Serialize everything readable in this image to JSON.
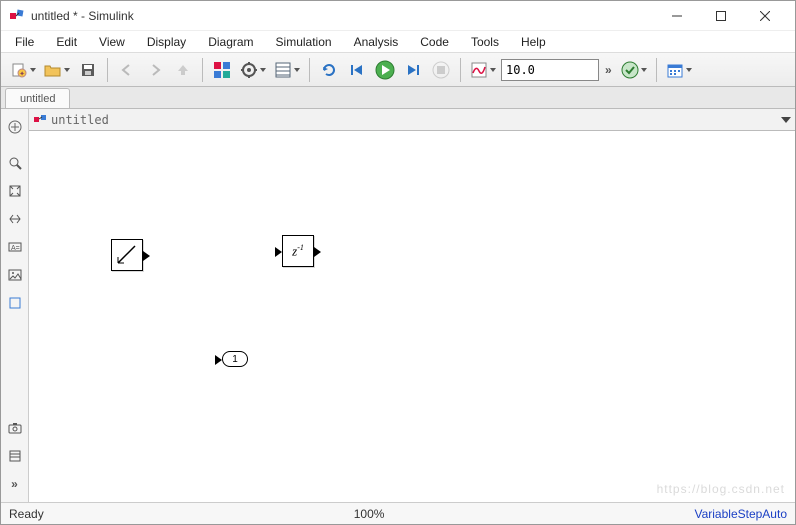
{
  "window": {
    "title": "untitled * - Simulink"
  },
  "menu": {
    "items": [
      "File",
      "Edit",
      "View",
      "Display",
      "Diagram",
      "Simulation",
      "Analysis",
      "Code",
      "Tools",
      "Help"
    ]
  },
  "toolbar": {
    "stop_time": "10.0"
  },
  "tabs": {
    "active": "untitled"
  },
  "breadcrumb": {
    "model": "untitled"
  },
  "canvas": {
    "blocks": {
      "ramp": {
        "type": "ramp"
      },
      "delay": {
        "label": "z",
        "exp": "-1"
      },
      "outport": {
        "label": "1"
      }
    }
  },
  "status": {
    "state": "Ready",
    "zoom": "100%",
    "solver": "VariableStepAuto"
  }
}
